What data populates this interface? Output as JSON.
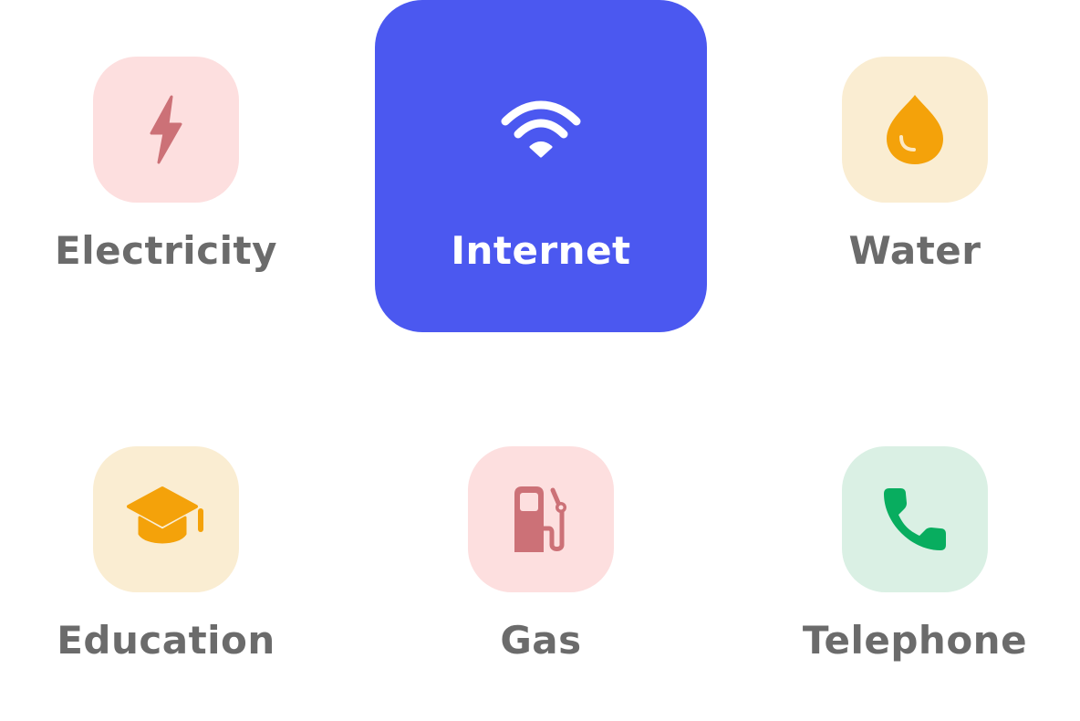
{
  "categories": [
    {
      "id": "electricity",
      "label": "Electricity",
      "icon": "lightning-icon",
      "bg": "#fddfdf",
      "fg": "#cc7177",
      "selected": false
    },
    {
      "id": "internet",
      "label": "Internet",
      "icon": "wifi-icon",
      "bg": "#4b58f0",
      "fg": "#ffffff",
      "selected": true
    },
    {
      "id": "water",
      "label": "Water",
      "icon": "water-drop-icon",
      "bg": "#faedd2",
      "fg": "#f4a20a",
      "selected": false
    },
    {
      "id": "education",
      "label": "Education",
      "icon": "graduation-cap-icon",
      "bg": "#faedd2",
      "fg": "#f4a20a",
      "selected": false
    },
    {
      "id": "gas",
      "label": "Gas",
      "icon": "fuel-pump-icon",
      "bg": "#fddfdf",
      "fg": "#cc7177",
      "selected": false
    },
    {
      "id": "telephone",
      "label": "Telephone",
      "icon": "phone-icon",
      "bg": "#daf0e4",
      "fg": "#08ad5f",
      "selected": false
    }
  ]
}
